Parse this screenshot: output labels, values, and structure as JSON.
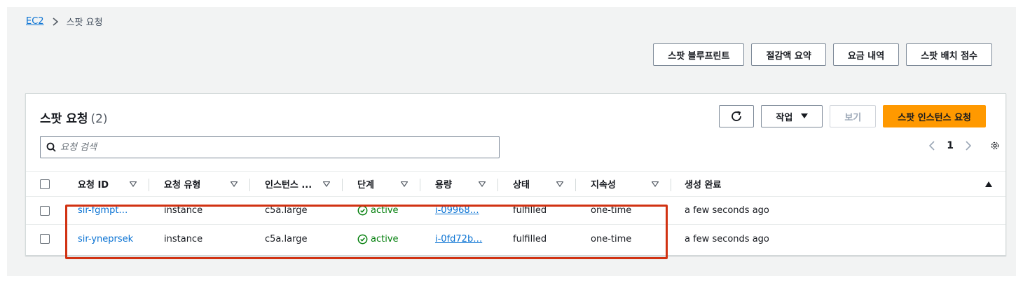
{
  "breadcrumb": {
    "root": "EC2",
    "current": "스팟 요청"
  },
  "top_actions": [
    "스팟 블루프린트",
    "절감액 요약",
    "요금 내역",
    "스팟 배치 점수"
  ],
  "panel": {
    "title": "스팟 요청",
    "count": "(2)",
    "actions_label": "작업",
    "view_label": "보기",
    "primary_label": "스팟 인스턴스 요청"
  },
  "search": {
    "placeholder": "요청 검색",
    "value": ""
  },
  "pagination": {
    "page": "1"
  },
  "columns": [
    "요청 ID",
    "요청 유형",
    "인스턴스 ...",
    "단계",
    "용량",
    "상태",
    "지속성",
    "생성 완료"
  ],
  "rows": [
    {
      "id": "sir-fgmpt…",
      "type": "instance",
      "instance": "c5a.large",
      "phase": "active",
      "capacity": "i-09968…",
      "state": "fulfilled",
      "persistence": "one-time",
      "created": "a few seconds ago"
    },
    {
      "id": "sir-yneprsek",
      "type": "instance",
      "instance": "c5a.large",
      "phase": "active",
      "capacity": "i-0fd72b…",
      "state": "fulfilled",
      "persistence": "one-time",
      "created": "a few seconds ago"
    }
  ],
  "colors": {
    "accent": "#0972d3",
    "primary": "#ff9900",
    "success": "#037f0c",
    "highlight": "#d13212"
  },
  "icons": [
    "chevron-right-icon",
    "refresh-icon",
    "caret-down-icon",
    "search-icon",
    "chevron-left-icon",
    "settings-icon",
    "sort-icon",
    "check-circle-icon"
  ]
}
